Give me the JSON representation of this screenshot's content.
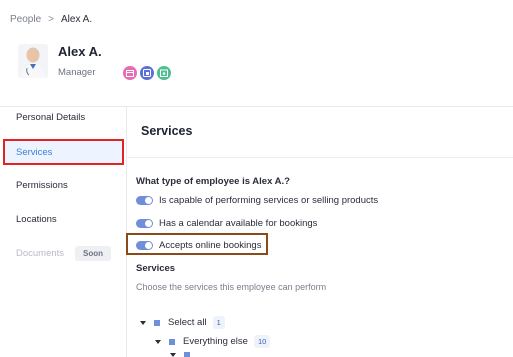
{
  "breadcrumb": {
    "root": "People",
    "separator": ">",
    "current": "Alex A."
  },
  "profile": {
    "name": "Alex A.",
    "role": "Manager",
    "badges": [
      {
        "icon": "calendar-icon",
        "color": "#e86bb6"
      },
      {
        "icon": "browser-icon",
        "color": "#5a6fd8"
      },
      {
        "icon": "booking-icon",
        "color": "#4fbf8f"
      }
    ]
  },
  "sidebar": {
    "items": [
      {
        "label": "Personal Details"
      },
      {
        "label": "Services",
        "active": true
      },
      {
        "label": "Permissions"
      },
      {
        "label": "Locations"
      },
      {
        "label": "Documents",
        "badge": "Soon",
        "disabled": true
      }
    ]
  },
  "main": {
    "title": "Services",
    "question": "What type of employee is Alex A.?",
    "toggles": [
      {
        "label": "Is capable of performing services or selling products",
        "on": true
      },
      {
        "label": "Has a calendar available for bookings",
        "on": true
      },
      {
        "label": "Accepts online bookings",
        "on": true
      }
    ],
    "services_label": "Services",
    "services_description": "Choose the services this employee can perform",
    "tree": [
      {
        "label": "Select all",
        "count": "1"
      },
      {
        "label": "Everything else",
        "count": "10"
      }
    ]
  },
  "colors": {
    "accent": "#6f8fda",
    "active_text": "#3b7fd6",
    "highlight_red": "#e02424",
    "highlight_brown": "#8a4a1a"
  }
}
